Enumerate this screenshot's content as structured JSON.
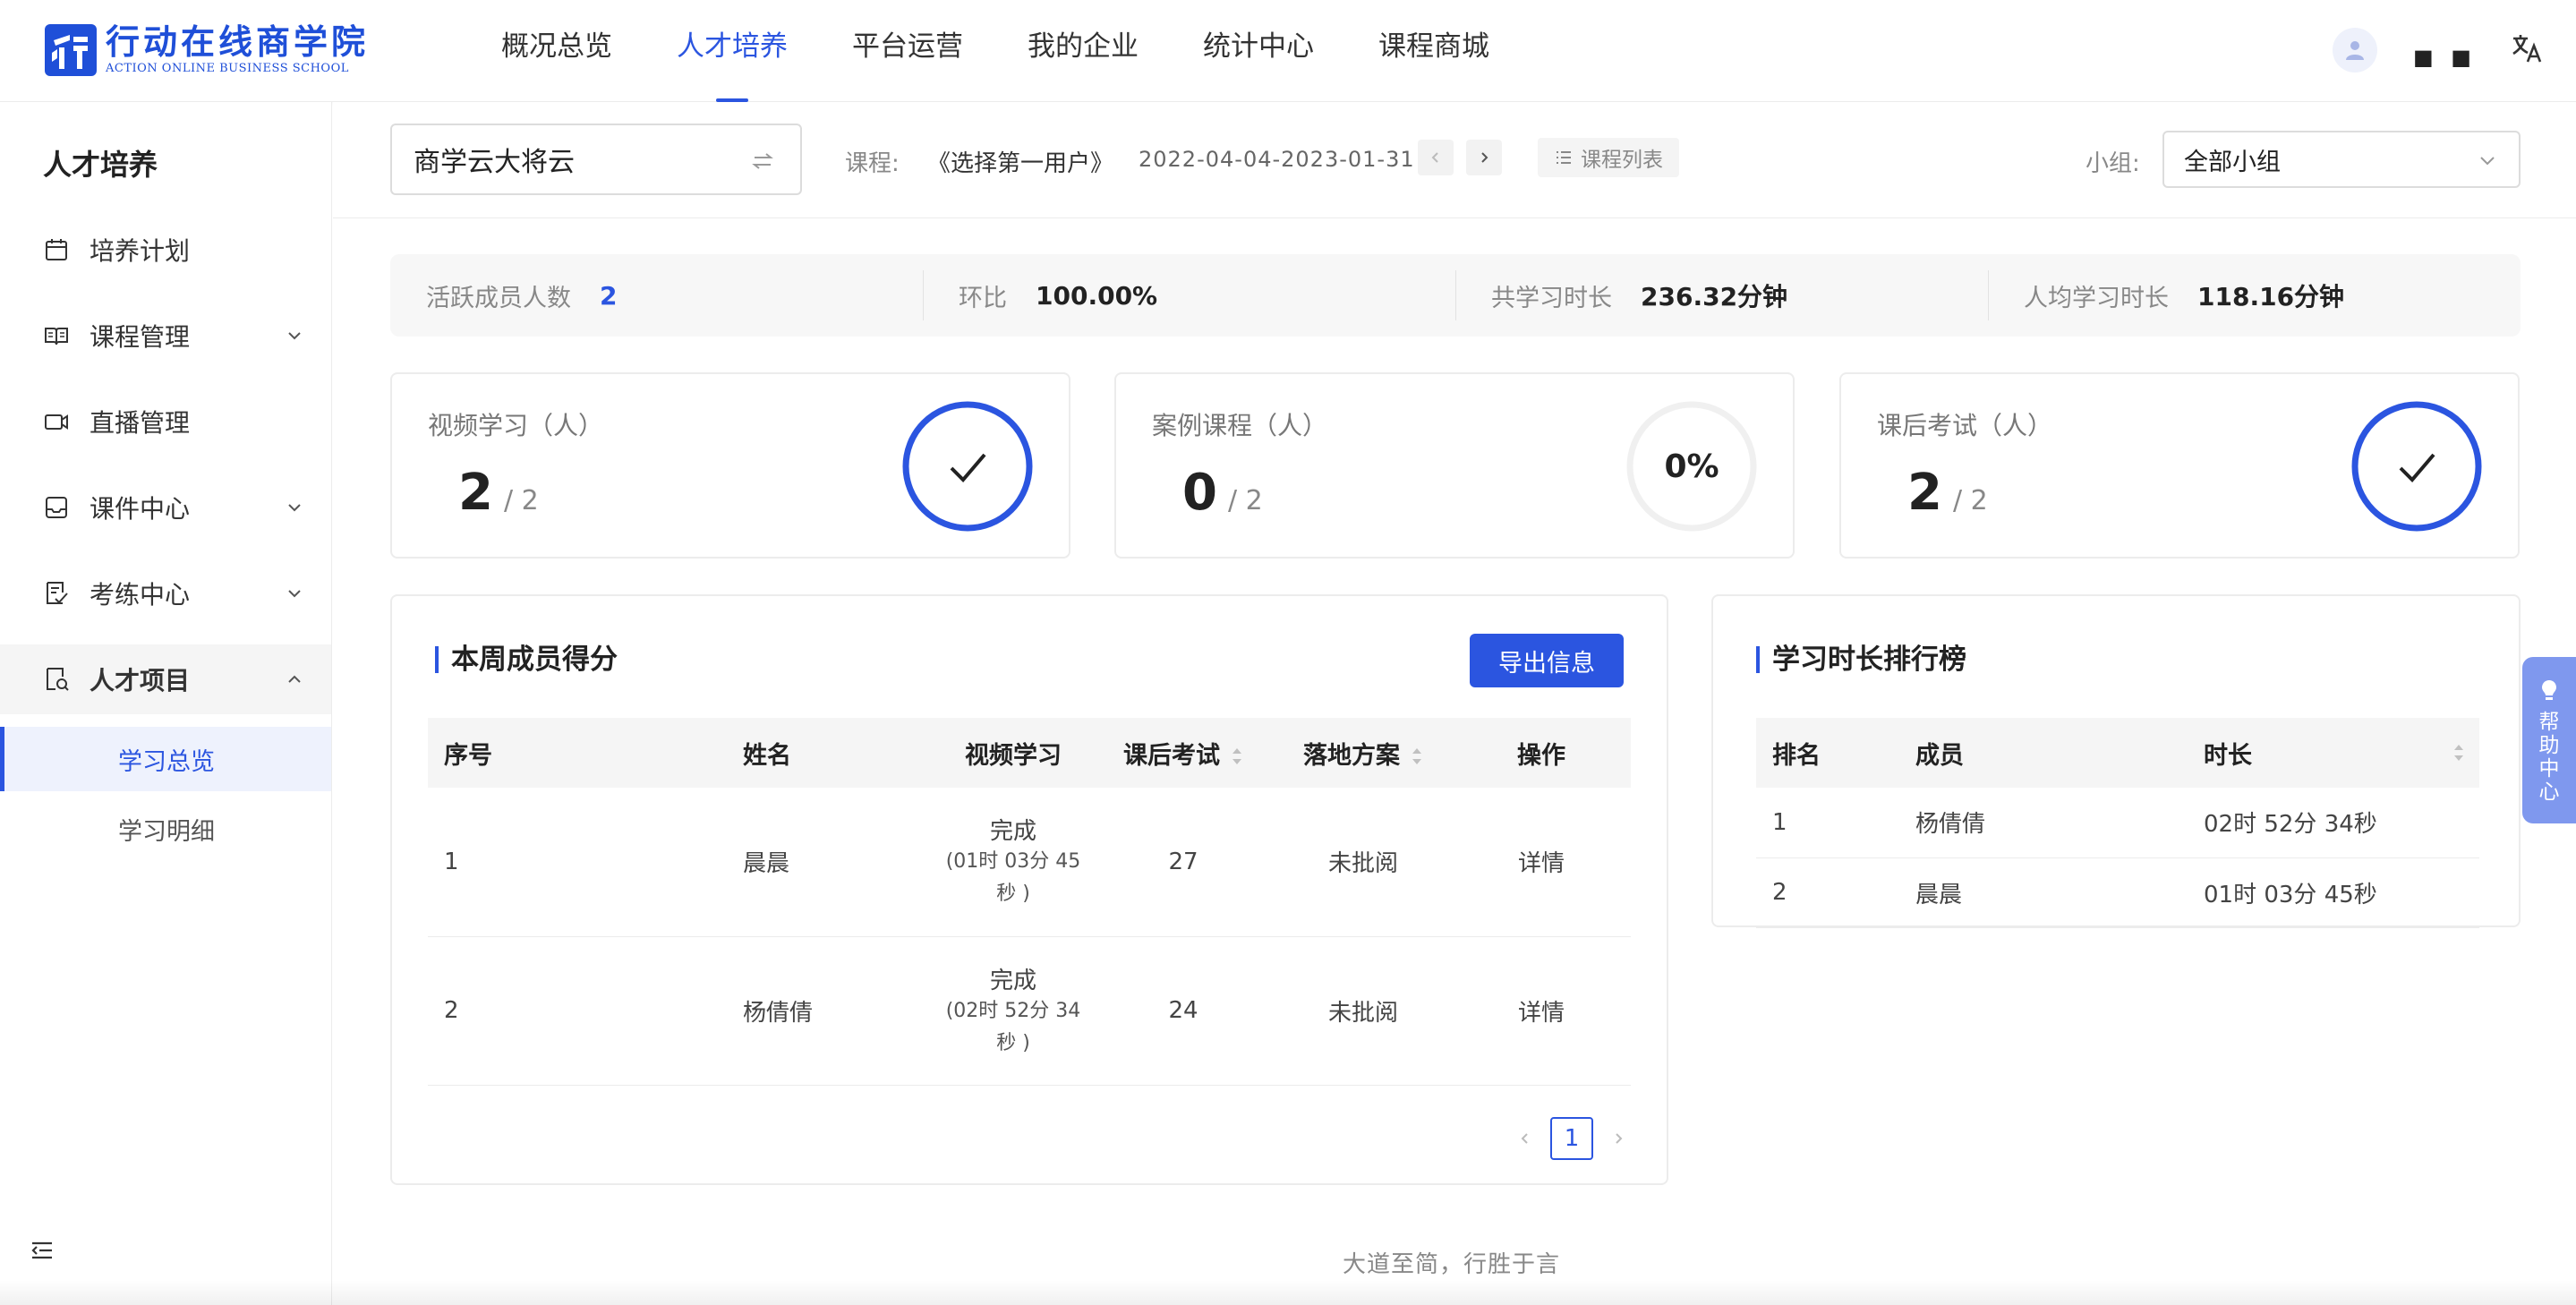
{
  "brand": {
    "title": "行动在线商学院",
    "subtitle": "ACTION ONLINE BUSINESS SCHOOL",
    "color": "#1f4fd8"
  },
  "nav": {
    "items": [
      "概况总览",
      "人才培养",
      "平台运营",
      "我的企业",
      "统计中心",
      "课程商城"
    ],
    "active": "人才培养"
  },
  "user": {
    "name": "■ ■",
    "avatar_icon": "user-avatar-icon",
    "lang_icon": "translate-icon"
  },
  "sidebar": {
    "title": "人才培养",
    "items": [
      {
        "label": "培养计划",
        "icon": "calendar-icon",
        "expandable": false
      },
      {
        "label": "课程管理",
        "icon": "book-icon",
        "expandable": true
      },
      {
        "label": "直播管理",
        "icon": "video-camera-icon",
        "expandable": false
      },
      {
        "label": "课件中心",
        "icon": "inbox-icon",
        "expandable": true
      },
      {
        "label": "考练中心",
        "icon": "exam-icon",
        "expandable": true
      },
      {
        "label": "人才项目",
        "icon": "project-icon",
        "expandable": true,
        "open": true
      }
    ],
    "sub_items": [
      {
        "label": "学习总览",
        "active": true
      },
      {
        "label": "学习明细",
        "active": false
      }
    ]
  },
  "filter": {
    "org": "商学云大将云",
    "course_label": "课程:",
    "course_name": "《选择第一用户》",
    "date_range": "2022-04-04-2023-01-31",
    "course_list": "课程列表",
    "group_label": "小组:",
    "group_value": "全部小组"
  },
  "summary": [
    {
      "label": "活跃成员人数",
      "value": "2",
      "highlight": true
    },
    {
      "label": "环比",
      "value": "100.00%",
      "highlight": false
    },
    {
      "label": "共学习时长",
      "value": "236.32分钟",
      "highlight": false
    },
    {
      "label": "人均学习时长",
      "value": "118.16分钟",
      "highlight": false
    }
  ],
  "stats": [
    {
      "label": "视频学习（人）",
      "value": "2",
      "total": "/ 2",
      "progress": 1.0,
      "ring_text": ""
    },
    {
      "label": "案例课程（人）",
      "value": "0",
      "total": "/ 2",
      "progress": 0.0,
      "ring_text": "0%"
    },
    {
      "label": "课后考试（人）",
      "value": "2",
      "total": "/ 2",
      "progress": 1.0,
      "ring_text": ""
    }
  ],
  "score_panel": {
    "title": "本周成员得分",
    "export": "导出信息",
    "columns": [
      "序号",
      "姓名",
      "视频学习",
      "课后考试",
      "落地方案",
      "操作"
    ],
    "rows": [
      {
        "index": "1",
        "name": "晨晨",
        "video_status": "完成",
        "video_time": "(01时 03分 45",
        "video_time2": "秒 )",
        "exam": "27",
        "plan": "未批阅",
        "action": "详情"
      },
      {
        "index": "2",
        "name": "杨倩倩",
        "video_status": "完成",
        "video_time": "(02时 52分 34",
        "video_time2": "秒 )",
        "exam": "24",
        "plan": "未批阅",
        "action": "详情"
      }
    ],
    "page": "1"
  },
  "rank_panel": {
    "title": "学习时长排行榜",
    "columns": [
      "排名",
      "成员",
      "时长"
    ],
    "rows": [
      {
        "rank": "1",
        "member": "杨倩倩",
        "duration": "02时 52分 34秒"
      },
      {
        "rank": "2",
        "member": "晨晨",
        "duration": "01时 03分 45秒"
      }
    ]
  },
  "help": {
    "label": "帮助中心"
  },
  "footer": {
    "slogan": "大道至简，行胜于言"
  },
  "colors": {
    "accent": "#2b55e0",
    "rank1": "#e03c2d",
    "rank2": "#f06a1f",
    "help_tab": "#7f98ee"
  }
}
